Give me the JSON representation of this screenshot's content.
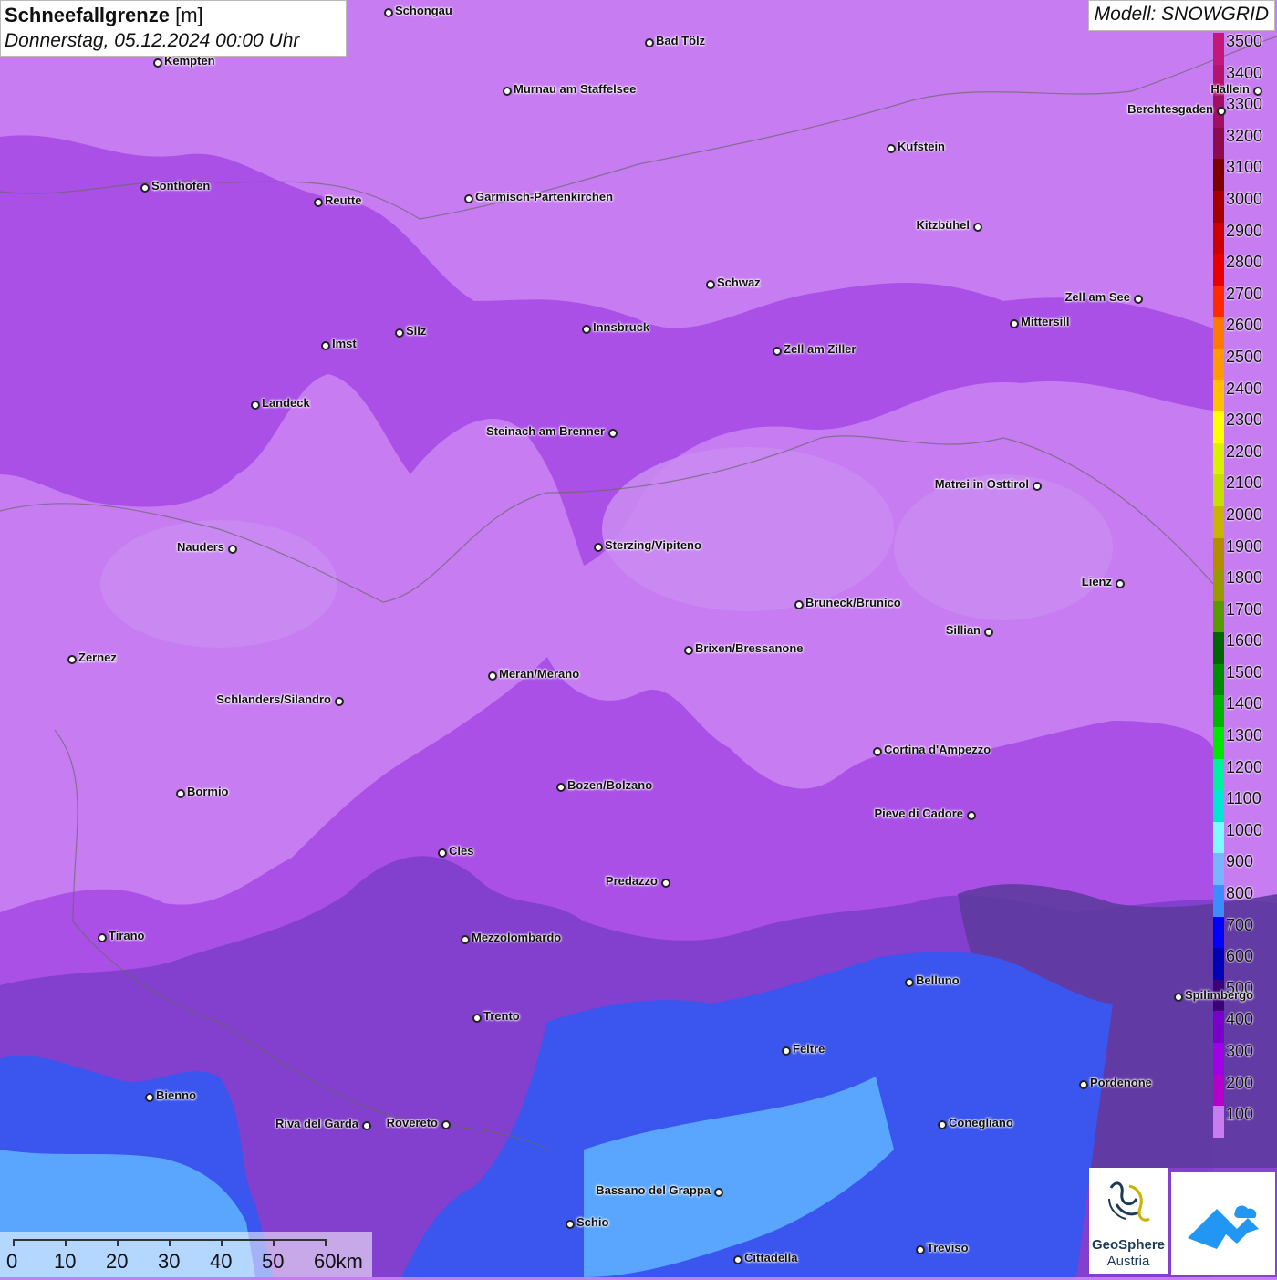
{
  "header": {
    "title": "Schneefallgrenze",
    "unit": "[m]",
    "datetime": "Donnerstag, 05.12.2024 00:00 Uhr",
    "model": "Modell: SNOWGRID"
  },
  "legend": {
    "entries": [
      {
        "label": "3500",
        "color": "#c2187a"
      },
      {
        "label": "3400",
        "color": "#b3146e"
      },
      {
        "label": "3300",
        "color": "#a01062"
      },
      {
        "label": "3200",
        "color": "#8a0c4e"
      },
      {
        "label": "3100",
        "color": "#7a0000"
      },
      {
        "label": "3000",
        "color": "#a50000"
      },
      {
        "label": "2900",
        "color": "#cc0000"
      },
      {
        "label": "2800",
        "color": "#e60000"
      },
      {
        "label": "2700",
        "color": "#ff2a00"
      },
      {
        "label": "2600",
        "color": "#ff7a00"
      },
      {
        "label": "2500",
        "color": "#ff9a00"
      },
      {
        "label": "2400",
        "color": "#ffbf00"
      },
      {
        "label": "2300",
        "color": "#ffff00"
      },
      {
        "label": "2200",
        "color": "#d9f000"
      },
      {
        "label": "2100",
        "color": "#c6df00"
      },
      {
        "label": "2000",
        "color": "#c8b400"
      },
      {
        "label": "1900",
        "color": "#b48c00"
      },
      {
        "label": "1800",
        "color": "#9a9a00"
      },
      {
        "label": "1700",
        "color": "#5a9a00"
      },
      {
        "label": "1600",
        "color": "#006400"
      },
      {
        "label": "1500",
        "color": "#008c00"
      },
      {
        "label": "1400",
        "color": "#00b400"
      },
      {
        "label": "1300",
        "color": "#00e600"
      },
      {
        "label": "1200",
        "color": "#00f0a0"
      },
      {
        "label": "1100",
        "color": "#00e6d2"
      },
      {
        "label": "1000",
        "color": "#7df9ff"
      },
      {
        "label": "900",
        "color": "#78b4ff"
      },
      {
        "label": "800",
        "color": "#3c8cff"
      },
      {
        "label": "700",
        "color": "#0000ff"
      },
      {
        "label": "600",
        "color": "#0000b4"
      },
      {
        "label": "500",
        "color": "#3c0078"
      },
      {
        "label": "400",
        "color": "#7800c8"
      },
      {
        "label": "300",
        "color": "#a000e6"
      },
      {
        "label": "200",
        "color": "#b400c8"
      },
      {
        "label": "100",
        "color": "#c87cf0"
      }
    ]
  },
  "cities": [
    {
      "name": "Schongau"
    },
    {
      "name": "Kempten"
    },
    {
      "name": "Bad Tölz"
    },
    {
      "name": "Murnau am Staffelsee"
    },
    {
      "name": "Hallein"
    },
    {
      "name": "Berchtesgaden"
    },
    {
      "name": "Kufstein"
    },
    {
      "name": "Sonthofen"
    },
    {
      "name": "Reutte"
    },
    {
      "name": "Garmisch-Partenkirchen"
    },
    {
      "name": "Kitzbühel"
    },
    {
      "name": "Schwaz"
    },
    {
      "name": "Zell am See"
    },
    {
      "name": "Mittersill"
    },
    {
      "name": "Innsbruck"
    },
    {
      "name": "Imst"
    },
    {
      "name": "Silz"
    },
    {
      "name": "Zell am Ziller"
    },
    {
      "name": "Landeck"
    },
    {
      "name": "Steinach am Brenner"
    },
    {
      "name": "Matrei in Osttirol"
    },
    {
      "name": "Nauders"
    },
    {
      "name": "Sterzing/Vipiteno"
    },
    {
      "name": "Lienz"
    },
    {
      "name": "Bruneck/Brunico"
    },
    {
      "name": "Sillian"
    },
    {
      "name": "Brixen/Bressanone"
    },
    {
      "name": "Zernez"
    },
    {
      "name": "Meran/Merano"
    },
    {
      "name": "Schlanders/Silandro"
    },
    {
      "name": "Cortina d'Ampezzo"
    },
    {
      "name": "Bozen/Bolzano"
    },
    {
      "name": "Bormio"
    },
    {
      "name": "Pieve di Cadore"
    },
    {
      "name": "Cles"
    },
    {
      "name": "Predazzo"
    },
    {
      "name": "Tirano"
    },
    {
      "name": "Mezzolombardo"
    },
    {
      "name": "Belluno"
    },
    {
      "name": "Spilimbergo"
    },
    {
      "name": "Trento"
    },
    {
      "name": "Feltre"
    },
    {
      "name": "Pordenone"
    },
    {
      "name": "Bienno"
    },
    {
      "name": "Riva del Garda"
    },
    {
      "name": "Rovereto"
    },
    {
      "name": "Conegliano"
    },
    {
      "name": "Bassano del Grappa"
    },
    {
      "name": "Schio"
    },
    {
      "name": "Treviso"
    },
    {
      "name": "Cittadella"
    }
  ],
  "scale": {
    "labels": [
      "0",
      "10",
      "20",
      "30",
      "40",
      "50",
      "60km"
    ]
  },
  "logos": {
    "geosphere_line1": "GeoSphere",
    "geosphere_line2": "Austria"
  },
  "colors": {
    "base": "#c77cf2",
    "mid_purple": "#a64be6",
    "dark_purple": "#8a3ad2",
    "deep": "#6a3aa8",
    "blue": "#3a5cf0",
    "light_blue": "#59a8ff"
  }
}
